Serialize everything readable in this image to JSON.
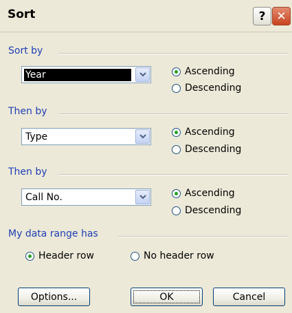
{
  "window": {
    "title": "Sort",
    "help_glyph": "?",
    "close_glyph": "✕"
  },
  "groups": [
    {
      "label": "Sort by",
      "field": "Year",
      "ascending": "Ascending",
      "descending": "Descending",
      "selected": "ascending"
    },
    {
      "label": "Then by",
      "field": "Type",
      "ascending": "Ascending",
      "descending": "Descending",
      "selected": "ascending"
    },
    {
      "label": "Then by",
      "field": "Call No.",
      "ascending": "Ascending",
      "descending": "Descending",
      "selected": "ascending"
    }
  ],
  "range": {
    "label": "My data range has",
    "header_row": "Header row",
    "no_header_row": "No header row",
    "selected": "header_row"
  },
  "buttons": {
    "options": "Options...",
    "ok": "OK",
    "cancel": "Cancel"
  },
  "colors": {
    "group_label": "#1f3eb5",
    "radio_dot": "#21a121",
    "close_button": "#c8431f"
  }
}
